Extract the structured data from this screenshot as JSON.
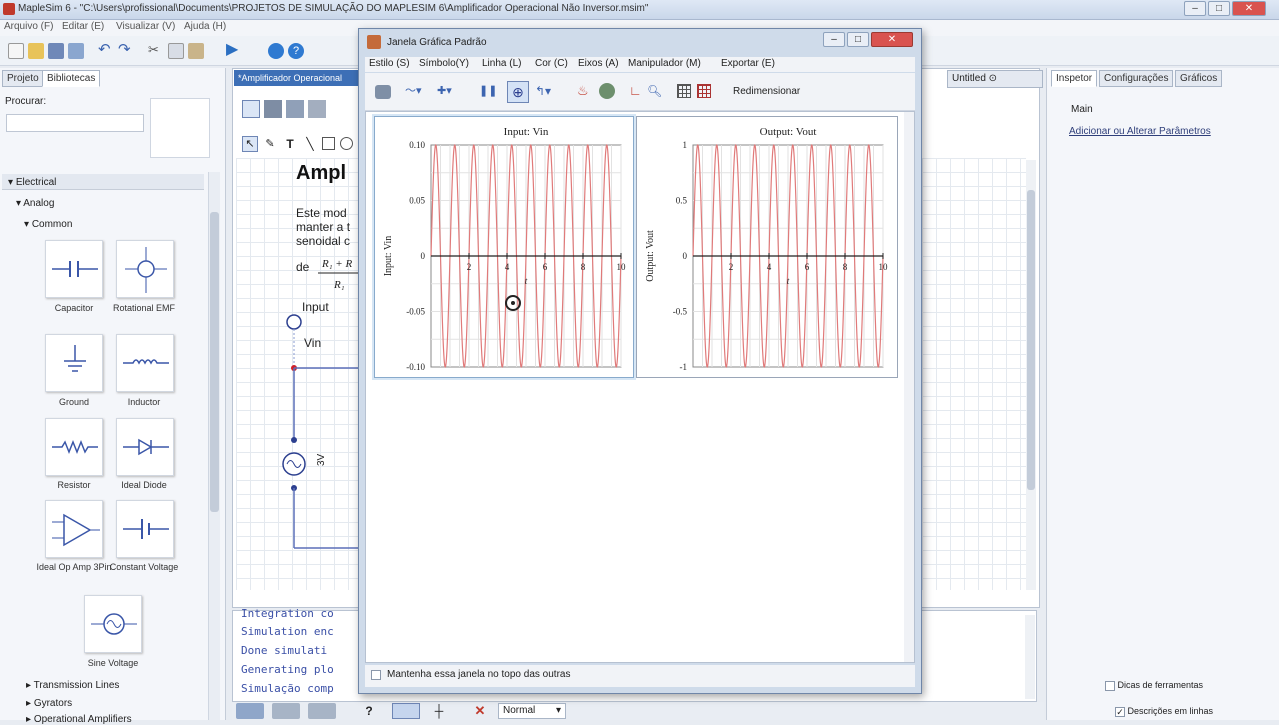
{
  "window": {
    "title": "MapleSim 6 - \"C:\\Users\\profissional\\Documents\\PROJETOS DE SIMULAÇÃO DO MAPLESIM 6\\Amplificador Operacional Não Inversor.msim\""
  },
  "menu": [
    "Arquivo (F)",
    "Editar (E)",
    "Visualizar (V)",
    "Ajuda (H)"
  ],
  "left_panel": {
    "tabs": [
      "Projeto",
      "Bibliotecas"
    ],
    "search_label": "Procurar:",
    "search_value": "",
    "tree": {
      "electrical": "Electrical",
      "analog": "Analog",
      "common": "Common",
      "transmission": "Transmission Lines",
      "gyrators": "Gyrators",
      "opamps": "Operational Amplifiers"
    },
    "components": [
      {
        "label": "Capacitor",
        "icon": "capacitor-icon"
      },
      {
        "label": "Rotational EMF",
        "icon": "rotational-emf-icon"
      },
      {
        "label": "Ground",
        "icon": "ground-icon"
      },
      {
        "label": "Inductor",
        "icon": "inductor-icon"
      },
      {
        "label": "Resistor",
        "icon": "resistor-icon"
      },
      {
        "label": "Ideal Diode",
        "icon": "diode-icon"
      },
      {
        "label": "Ideal Op Amp 3Pin",
        "icon": "opamp-icon"
      },
      {
        "label": "Constant Voltage",
        "icon": "constant-voltage-icon"
      },
      {
        "label": "Sine Voltage",
        "icon": "sine-voltage-icon"
      }
    ]
  },
  "document": {
    "tab": "*Amplificador Operacional",
    "heading": "Ampl",
    "text_lines": [
      "Este mod",
      "manter a t",
      "senoidal c",
      "de"
    ],
    "input_label": "Input",
    "vin_label": "Vin",
    "source_label": "3V"
  },
  "console": {
    "lines": [
      "Integration co",
      "Simulation enc",
      "Done simulati",
      "Generating plo",
      "Simulação comp"
    ]
  },
  "bottom_bar": {
    "mode": "Normal"
  },
  "right_panel": {
    "tabs": [
      "Inspetor",
      "Configurações",
      "Gráficos"
    ],
    "header_tab": "Untitled ⊙",
    "section": "Main",
    "link": "Adicionar ou Alterar Parâmetros",
    "checkboxes": [
      {
        "label": "Dicas de ferramentas",
        "checked": false
      },
      {
        "label": "Descrições em linhas",
        "checked": true
      }
    ]
  },
  "graph_window": {
    "title": "Janela Gráfica Padrão",
    "menu": [
      "Estilo (S)",
      "Símbolo(Y)",
      "Linha (L)",
      "Cor (C)",
      "Eixos (A)",
      "Manipulador (M)",
      "Exportar (E)"
    ],
    "resize_label": "Redimensionar",
    "keep_on_top_label": "Mantenha essa janela no topo das outras",
    "keep_on_top_checked": false
  },
  "chart_data": [
    {
      "type": "line",
      "title": "Input: Vin",
      "xlabel": "t",
      "ylabel": "Input: Vin",
      "xlim": [
        0,
        10
      ],
      "ylim": [
        -0.1,
        0.1
      ],
      "xticks": [
        2,
        4,
        6,
        8,
        10
      ],
      "yticks": [
        0.1,
        0.05,
        0,
        -0.05,
        -0.1
      ],
      "ytick_labels": [
        "0.10",
        "0.05",
        "0",
        "-0.05",
        "-0.10"
      ],
      "grid": true,
      "series": [
        {
          "amplitude": 0.1,
          "frequency_hz": 1,
          "color": "#e07a7a"
        }
      ]
    },
    {
      "type": "line",
      "title": "Output: Vout",
      "xlabel": "t",
      "ylabel": "Output: Vout",
      "xlim": [
        0,
        10
      ],
      "ylim": [
        -1,
        1
      ],
      "xticks": [
        2,
        4,
        6,
        8,
        10
      ],
      "yticks": [
        1,
        0.5,
        0,
        -0.5,
        -1
      ],
      "ytick_labels": [
        "1",
        "0.5",
        "0",
        "-0.5",
        "-1"
      ],
      "grid": true,
      "series": [
        {
          "amplitude": 1,
          "frequency_hz": 1,
          "color": "#e07a7a"
        }
      ]
    }
  ]
}
